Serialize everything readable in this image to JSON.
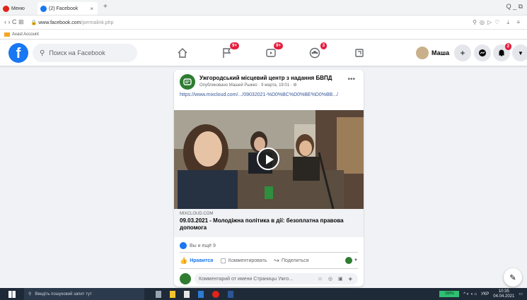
{
  "browser": {
    "tabs": [
      {
        "label": "Меню",
        "active": false
      },
      {
        "label": "(2) Facebook",
        "active": true
      }
    ],
    "new_tab": "+",
    "window_controls": "Q  _  ⧉",
    "url_domain": "www.facebook.com",
    "url_path": "/permalink.php",
    "nav_icons": "‹  ›  C  ⊞",
    "bookmark": "Avast Account",
    "right_icons": "⚲◎▷♡ ⤓ ≡"
  },
  "facebook": {
    "logo": "f",
    "search_placeholder": "Поиск на Facebook",
    "nav": [
      {
        "icon": "home-icon",
        "badge": ""
      },
      {
        "icon": "flag-icon",
        "badge": "9+"
      },
      {
        "icon": "video-icon",
        "badge": "9+"
      },
      {
        "icon": "groups-icon",
        "badge": "3"
      },
      {
        "icon": "gaming-icon",
        "badge": ""
      }
    ],
    "user_name": "Маша",
    "notification_badge": "2"
  },
  "post": {
    "page_name": "Ужгородський місцевий центр з надання БВПД",
    "meta": "Опубликовано Машей Рыжко · 9 марта, 19:01 · ⚙",
    "link_text": "https://www.mixcloud.com/.../09032021-%D0%BC%D0%BE%D0%BB.../",
    "link_domain": "MIXCLOUD.COM",
    "link_title": "09.03.2021 - Молодіжна політика в дії: безоплатна правова допомога",
    "reactions": "Вы и ещё 9",
    "actions": {
      "like": "Нравится",
      "comment": "Комментировать",
      "share": "Поделиться"
    },
    "comment_placeholder": "Комментарий от имени Страницы Ужго...",
    "comment_emojis": "☺ ◎ ▣ ◈"
  },
  "taskbar": {
    "search": "Введіть пошуковий запит тут",
    "battery": "100%",
    "lang": "УКР",
    "time": "10:35",
    "date": "04.04.2021"
  },
  "colors": {
    "facebook_blue": "#1877f2",
    "badge_red": "#e41e3f",
    "page_bg": "#f0f2f5"
  }
}
